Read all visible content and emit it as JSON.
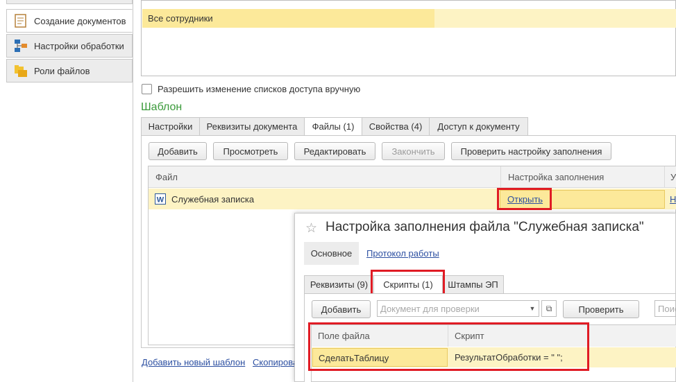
{
  "nav": {
    "items": [
      {
        "label": "Создание документов",
        "icon": "document-icon",
        "active": true
      },
      {
        "label": "Настройки обработки",
        "icon": "hierarchy-icon",
        "active": false
      },
      {
        "label": "Роли файлов",
        "icon": "folder-roles-icon",
        "active": false
      }
    ]
  },
  "access": {
    "list_item": "Все сотрудники",
    "allow_manual_label": "Разрешить изменение списков доступа вручную"
  },
  "template": {
    "section_title": "Шаблон",
    "tabs": [
      "Настройки",
      "Реквизиты документа",
      "Файлы (1)",
      "Свойства (4)",
      "Доступ к документу"
    ],
    "toolbar": {
      "add": "Добавить",
      "view": "Просмотреть",
      "edit": "Редактировать",
      "finish": "Закончить",
      "check": "Проверить настройку заполнения"
    },
    "grid": {
      "col_file": "Файл",
      "col_fill": "Настройка заполнения",
      "col_third": "У",
      "row_file": "Служебная записка",
      "row_fill_link": "Открыть",
      "row_third": "Н"
    },
    "bottom_links": {
      "add_template": "Добавить новый шаблон",
      "copy": "Скопирова"
    }
  },
  "dialog": {
    "title": "Настройка заполнения файла \"Служебная записка\"",
    "top_tabs": [
      "Основное",
      "Протокол работы"
    ],
    "tabs": [
      "Реквизиты (9)",
      "Скрипты (1)",
      "Штампы ЭП"
    ],
    "toolbar": {
      "add": "Добавить",
      "doc_placeholder": "Документ для проверки",
      "check": "Проверить",
      "search_placeholder": "Поис"
    },
    "grid": {
      "col_field": "Поле файла",
      "col_script": "Скрипт",
      "row_field": "СделатьТаблицу",
      "row_script": "РезультатОбработки = \" \";"
    }
  },
  "colors": {
    "highlight_red": "#e01b24",
    "selection_yellow": "#fce99a",
    "row_yellow": "#fdf3c4",
    "section_green": "#3a9a3a",
    "link_blue": "#2c4fa1"
  }
}
